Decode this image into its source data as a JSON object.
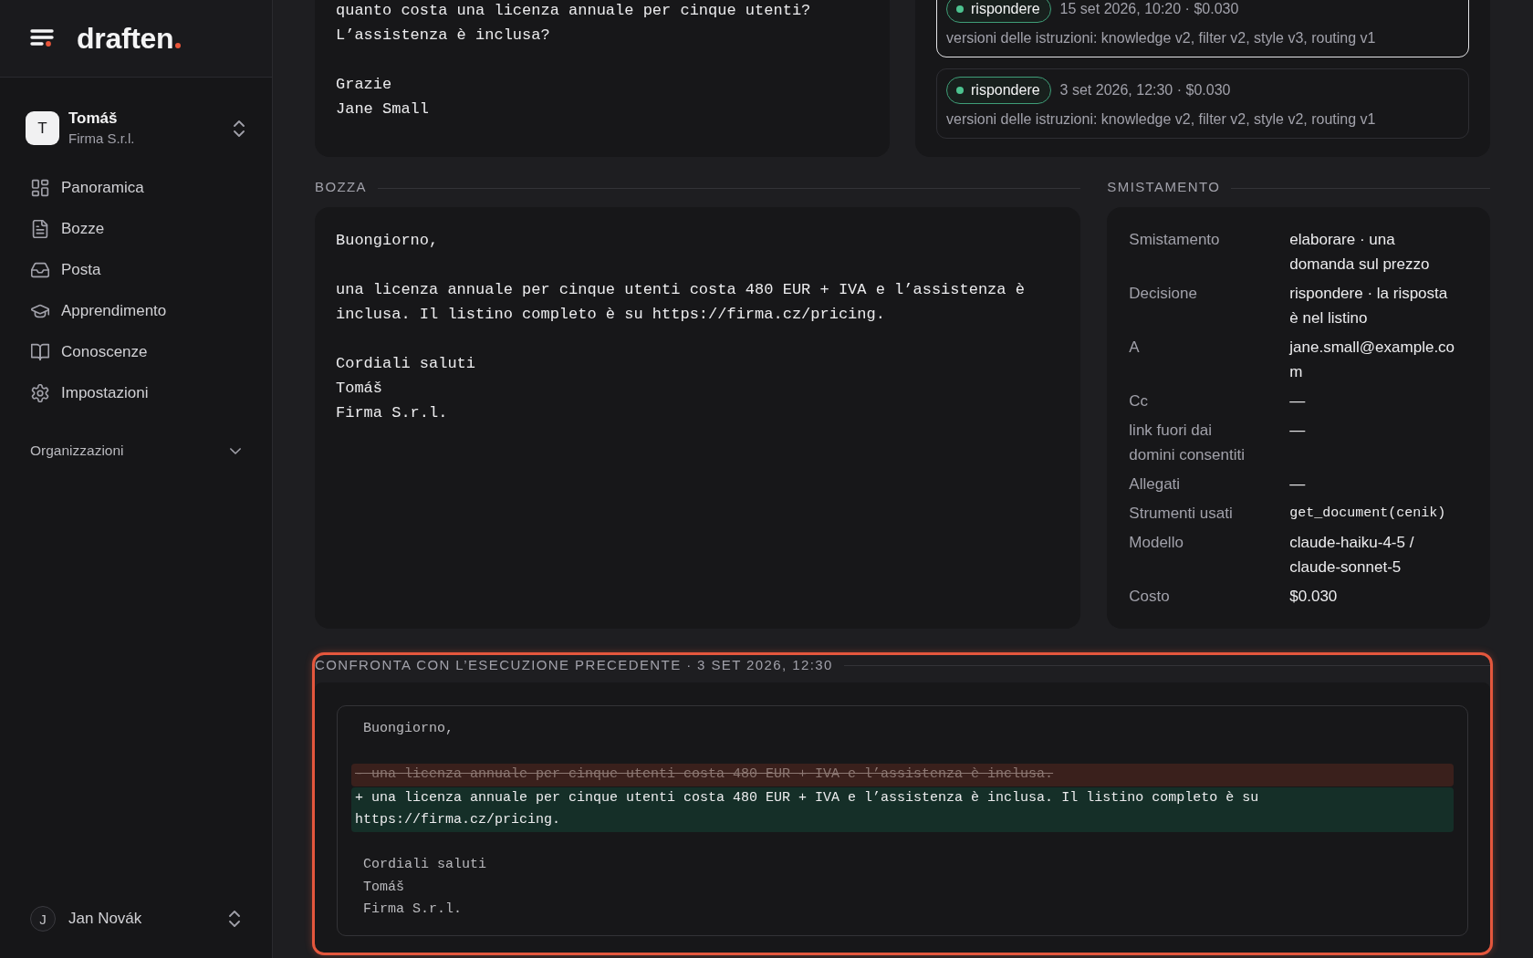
{
  "sidebar": {
    "logo": "draften",
    "organization": {
      "avatar": "T",
      "name": "Tomáš",
      "subtitle": "Firma S.r.l."
    },
    "nav": [
      {
        "label": "Panoramica",
        "selected": false
      },
      {
        "label": "Bozze",
        "selected": false
      },
      {
        "label": "Posta",
        "selected": false
      },
      {
        "label": "Apprendimento",
        "selected": false
      },
      {
        "label": "Conoscenze",
        "selected": false
      },
      {
        "label": "Impostazioni",
        "selected": false
      }
    ],
    "section": {
      "label": "Organizzazioni",
      "expanded": false
    },
    "user": {
      "avatar": "J",
      "name": "Jan Novák"
    }
  },
  "email": {
    "paragraphs": [
      [
        "quanto costa una licenza annuale per cinque utenti?",
        "L’assistenza è inclusa?"
      ],
      [
        "Grazie",
        "Jane Small"
      ]
    ]
  },
  "runs": [
    {
      "decision": "rispondere",
      "meta": "15 set 2026, 10:20 · $0.030",
      "versions": "versioni delle istruzioni: knowledge v2, filter v2, style v3, routing v1",
      "selected": true
    },
    {
      "decision": "rispondere",
      "meta": "3 set 2026, 12:30 · $0.030",
      "versions": "versioni delle istruzioni: knowledge v2, filter v2, style v2, routing v1",
      "selected": false
    }
  ],
  "draft": {
    "title": "BOZZA",
    "paragraphs": [
      [
        "Buongiorno,"
      ],
      [
        "una licenza annuale per cinque utenti costa 480 EUR + IVA e l’assistenza è inclusa. Il listino completo è su https://firma.cz/pricing."
      ],
      [
        "Cordiali saluti",
        "Tomáš",
        "Firma S.r.l."
      ]
    ]
  },
  "triage": {
    "title": "SMISTAMENTO",
    "rows": [
      {
        "label": "Smistamento",
        "value": "elaborare · una domanda sul prezzo",
        "kind": "text"
      },
      {
        "label": "Decisione",
        "value": "rispondere · la risposta è nel listino",
        "kind": "text"
      },
      {
        "label": "A",
        "value": "jane.small@example.com",
        "kind": "text"
      },
      {
        "label": "Cc",
        "value": "—",
        "kind": "text"
      },
      {
        "label": "link fuori dai domini consentiti",
        "value": "—",
        "kind": "text"
      },
      {
        "label": "Allegati",
        "value": "—",
        "kind": "text"
      },
      {
        "label": "Strumenti usati",
        "value": "get_document(cenik)",
        "kind": "code"
      },
      {
        "label": "Modello",
        "value": "claude-haiku-4-5 / claude-sonnet-5",
        "kind": "text"
      },
      {
        "label": "Costo",
        "value": "$0.030",
        "kind": "text"
      }
    ]
  },
  "compare": {
    "title": "CONFRONTA CON L’ESECUZIONE PRECEDENTE · 3 SET 2026, 12:30",
    "highlighted": true,
    "lines": [
      {
        "kind": "context",
        "text": "Buongiorno,"
      },
      {
        "kind": "blank"
      },
      {
        "kind": "removed",
        "text": "- una licenza annuale per cinque utenti costa 480 EUR + IVA e l’assistenza è inclusa."
      },
      {
        "kind": "added",
        "text": "+ una licenza annuale per cinque utenti costa 480 EUR + IVA e l’assistenza è inclusa. Il listino completo è su https://firma.cz/pricing."
      },
      {
        "kind": "blank"
      },
      {
        "kind": "context",
        "text": "Cordiali saluti"
      },
      {
        "kind": "context",
        "text": "Tomáš"
      },
      {
        "kind": "context",
        "text": "Firma S.r.l."
      }
    ]
  }
}
